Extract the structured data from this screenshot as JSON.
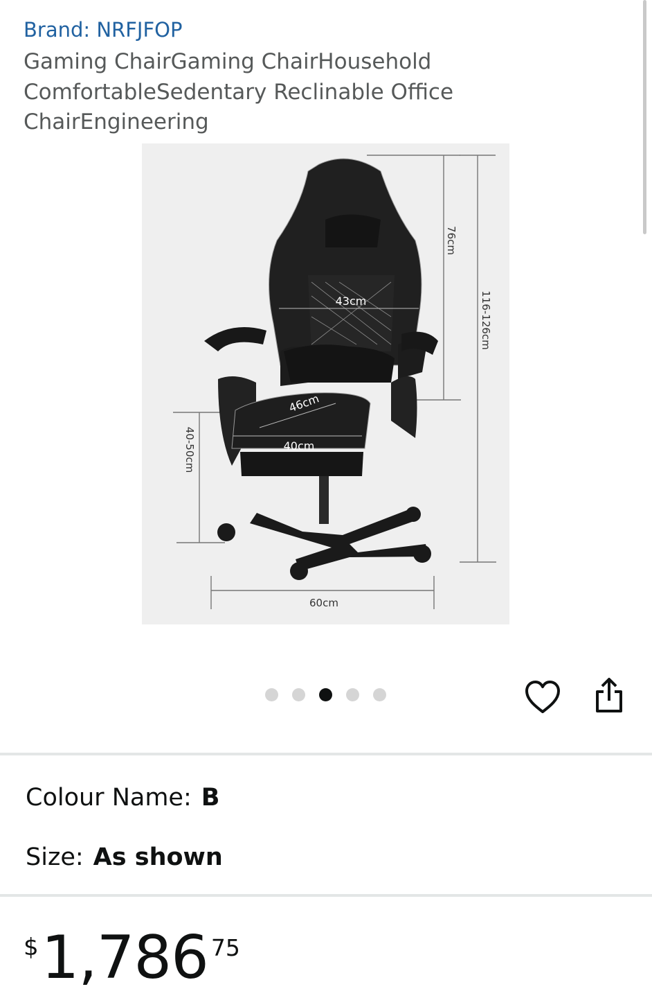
{
  "product": {
    "brand": "Brand: NRFJFOP",
    "title": "Gaming ChairGaming ChairHousehold ComfortableSedentary Reclinable Office ChairEngineering"
  },
  "image": {
    "dimensions": {
      "backrest_height": "76cm",
      "total_height": "116-126cm",
      "back_width": "43cm",
      "seat_depth": "46cm",
      "seat_width": "40cm",
      "seat_height": "40-50cm",
      "base_width": "60cm"
    },
    "carousel": {
      "count": 5,
      "active_index": 2
    }
  },
  "actions": {
    "wishlist_icon": "heart-icon",
    "share_icon": "share-icon"
  },
  "variations": {
    "colour": {
      "label": "Colour Name:",
      "value": "B"
    },
    "size": {
      "label": "Size:",
      "value": "As shown"
    }
  },
  "price": {
    "currency": "$",
    "whole": "1,786",
    "fraction": "75"
  },
  "colors": {
    "link": "#2162a1",
    "text": "#0f1111",
    "muted": "#565959",
    "divider": "#e3e6e6"
  }
}
